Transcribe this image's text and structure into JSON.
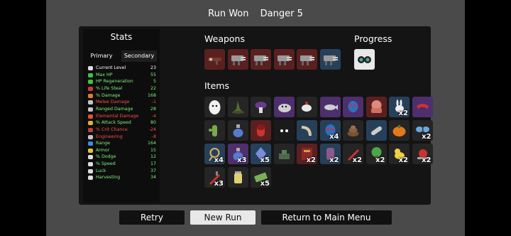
{
  "header": {
    "result": "Run Won",
    "danger": "Danger 5"
  },
  "stats": {
    "title": "Stats",
    "tabs": {
      "primary": "Primary",
      "secondary": "Secondary"
    },
    "rows": [
      {
        "label": "Current Level",
        "value": "23",
        "color": "#ffffff",
        "icon_color": "#dddddd",
        "icon": "head-icon"
      },
      {
        "label": "Max HP",
        "value": "55",
        "color": "#7ef07e",
        "icon_color": "#3ec43e",
        "icon": "heart-icon"
      },
      {
        "label": "HP Regeneration",
        "value": "5",
        "color": "#7ef07e",
        "icon_color": "#3ec43e",
        "icon": "regen-icon"
      },
      {
        "label": "% Life Steal",
        "value": "22",
        "color": "#7ef07e",
        "icon_color": "#c43e3e",
        "icon": "life-steal-icon"
      },
      {
        "label": "% Damage",
        "value": "168",
        "color": "#7ef07e",
        "icon_color": "#e07a3a",
        "icon": "damage-icon"
      },
      {
        "label": "Melee Damage",
        "value": "-1",
        "color": "#ff4a4a",
        "icon_color": "#c4c4c4",
        "icon": "melee-icon"
      },
      {
        "label": "Ranged Damage",
        "value": "28",
        "color": "#7ef07e",
        "icon_color": "#c4c4c4",
        "icon": "ranged-icon"
      },
      {
        "label": "Elemental Damage",
        "value": "-4",
        "color": "#ff4a4a",
        "icon_color": "#e0503a",
        "icon": "fire-icon"
      },
      {
        "label": "% Attack Speed",
        "value": "80",
        "color": "#7ef07e",
        "icon_color": "#e0b03a",
        "icon": "attack-speed-icon"
      },
      {
        "label": "% Crit Chance",
        "value": "-24",
        "color": "#ff4a4a",
        "icon_color": "#c43e3e",
        "icon": "crit-icon"
      },
      {
        "label": "Engineering",
        "value": "-8",
        "color": "#ff4a4a",
        "icon_color": "#c4c4c4",
        "icon": "wrench-icon"
      },
      {
        "label": "Range",
        "value": "164",
        "color": "#7ef07e",
        "icon_color": "#3a8ee0",
        "icon": "range-icon"
      },
      {
        "label": "Armor",
        "value": "15",
        "color": "#7ef07e",
        "icon_color": "#e0c43a",
        "icon": "shield-icon"
      },
      {
        "label": "% Dodge",
        "value": "12",
        "color": "#7ef07e",
        "icon_color": "#dddddd",
        "icon": "dodge-icon"
      },
      {
        "label": "% Speed",
        "value": "17",
        "color": "#7ef07e",
        "icon_color": "#dddddd",
        "icon": "speed-icon"
      },
      {
        "label": "Luck",
        "value": "37",
        "color": "#7ef07e",
        "icon_color": "#dddddd",
        "icon": "clover-icon"
      },
      {
        "label": "Harvesting",
        "value": "34",
        "color": "#7ef07e",
        "icon_color": "#dddddd",
        "icon": "harvest-icon"
      }
    ]
  },
  "weapons": {
    "title": "Weapons",
    "slots": [
      {
        "icon": "rocket-launcher-icon",
        "tier": "red",
        "qty": ""
      },
      {
        "icon": "minigun-icon",
        "tier": "red",
        "qty": ""
      },
      {
        "icon": "minigun-icon",
        "tier": "red",
        "qty": ""
      },
      {
        "icon": "minigun-icon",
        "tier": "red",
        "qty": ""
      },
      {
        "icon": "minigun-icon",
        "tier": "red",
        "qty": ""
      },
      {
        "icon": "minigun-icon",
        "tier": "blue",
        "qty": ""
      }
    ]
  },
  "progress": {
    "title": "Progress",
    "slots": [
      {
        "icon": "binoculars-icon",
        "tier": "white",
        "qty": ""
      }
    ]
  },
  "items": {
    "title": "Items",
    "slots": [
      {
        "icon": "egg-icon",
        "tier": "grey",
        "qty": ""
      },
      {
        "icon": "witch-hat-icon",
        "tier": "grey",
        "qty": ""
      },
      {
        "icon": "mushroom-icon",
        "tier": "grey",
        "qty": ""
      },
      {
        "icon": "blob-creature-icon",
        "tier": "purple",
        "qty": ""
      },
      {
        "icon": "teapot-icon",
        "tier": "grey",
        "qty": ""
      },
      {
        "icon": "fish-icon",
        "tier": "purple",
        "qty": ""
      },
      {
        "icon": "alien-icon",
        "tier": "purple",
        "qty": ""
      },
      {
        "icon": "octopus-icon",
        "tier": "red",
        "qty": ""
      },
      {
        "icon": "rabbit-icon",
        "tier": "blue",
        "qty": "x2"
      },
      {
        "icon": "scarf-icon",
        "tier": "purple",
        "qty": ""
      },
      {
        "icon": "cactus-hand-icon",
        "tier": "grey",
        "qty": ""
      },
      {
        "icon": "potion-icon",
        "tier": "grey",
        "qty": ""
      },
      {
        "icon": "capsule-icon",
        "tier": "red",
        "qty": ""
      },
      {
        "icon": "eyes-icon",
        "tier": "dark",
        "qty": ""
      },
      {
        "icon": "horn-icon",
        "tier": "blue",
        "qty": ""
      },
      {
        "icon": "alien-icon",
        "tier": "blue",
        "qty": "x4"
      },
      {
        "icon": "poop-icon",
        "tier": "grey",
        "qty": ""
      },
      {
        "icon": "bandage-icon",
        "tier": "blue",
        "qty": ""
      },
      {
        "icon": "pumpkin-icon",
        "tier": "grey",
        "qty": ""
      },
      {
        "icon": "butterfly-icon",
        "tier": "grey",
        "qty": "x2"
      },
      {
        "icon": "lasso-icon",
        "tier": "blue",
        "qty": "x4"
      },
      {
        "icon": "potion-icon",
        "tier": "purple",
        "qty": "x3"
      },
      {
        "icon": "crystal-icon",
        "tier": "blue",
        "qty": "x5"
      },
      {
        "icon": "turret-icon",
        "tier": "grey",
        "qty": ""
      },
      {
        "icon": "spellbook-icon",
        "tier": "red",
        "qty": "x2"
      },
      {
        "icon": "gauntlet-icon",
        "tier": "blue",
        "qty": "x2"
      },
      {
        "icon": "knife-icon",
        "tier": "grey",
        "qty": "x2"
      },
      {
        "icon": "tree-icon",
        "tier": "grey",
        "qty": "x2"
      },
      {
        "icon": "duck-icon",
        "tier": "grey",
        "qty": "x2"
      },
      {
        "icon": "snail-icon",
        "tier": "grey",
        "qty": "x2"
      },
      {
        "icon": "sword-icon",
        "tier": "grey",
        "qty": "x3"
      },
      {
        "icon": "jar-icon",
        "tier": "grey",
        "qty": ""
      },
      {
        "icon": "cash-icon",
        "tier": "grey",
        "qty": "x5"
      }
    ]
  },
  "buttons": {
    "retry": "Retry",
    "new_run": "New Run",
    "main_menu": "Return to Main Menu"
  },
  "colors": {
    "tier_grey": "#252525",
    "tier_blue": "#27405a",
    "tier_purple": "#4d2f6e",
    "tier_red": "#5a2020",
    "panel": "#141414",
    "screen": "#4a4a4a"
  }
}
